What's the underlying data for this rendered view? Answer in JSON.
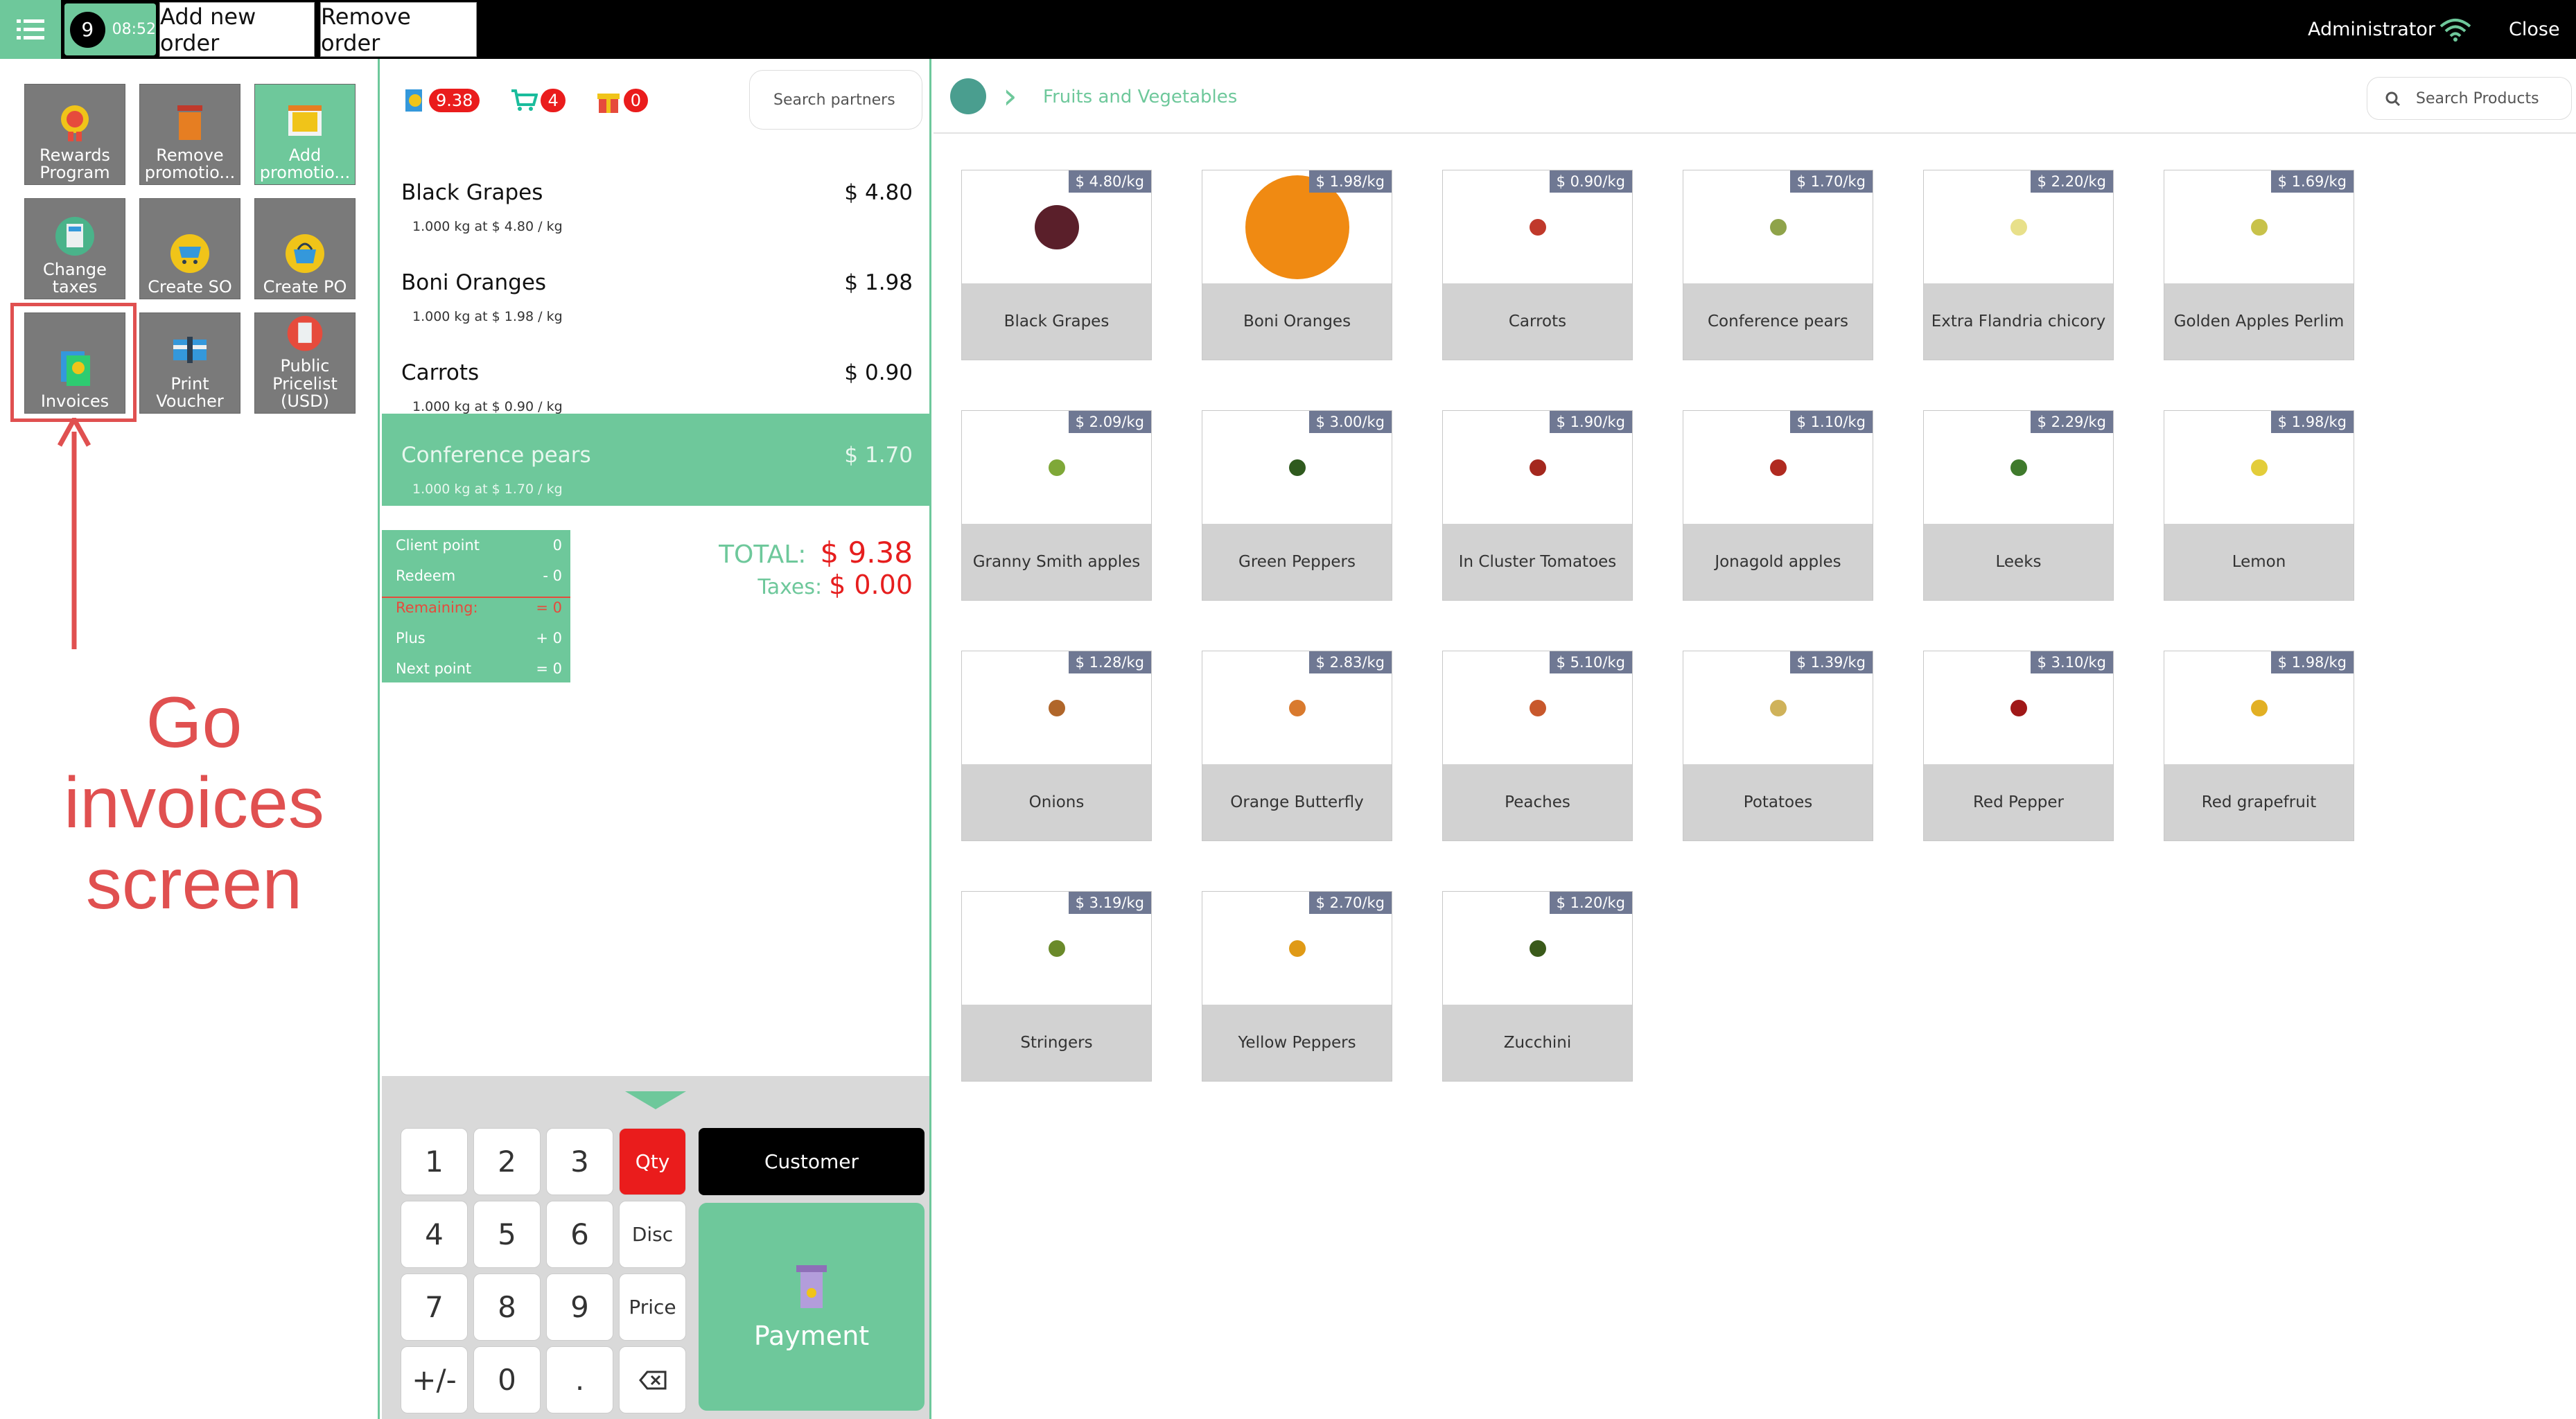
{
  "topbar": {
    "order_number": "9",
    "order_time": "08:52",
    "add_order_label": "Add new order",
    "remove_order_label": "Remove order",
    "user": "Administrator",
    "close_label": "Close"
  },
  "controls": [
    {
      "label": "Rewards\nProgram",
      "icon": "medal-icon",
      "style": "gray"
    },
    {
      "label": "Remove\npromotio...",
      "icon": "trash-icon",
      "style": "gray"
    },
    {
      "label": "Add\npromotio...",
      "icon": "promo-icon",
      "style": "green"
    },
    {
      "label": "Change\ntaxes",
      "icon": "calculator-icon",
      "style": "gray"
    },
    {
      "label": "Create SO",
      "icon": "cart-icon",
      "style": "gray"
    },
    {
      "label": "Create PO",
      "icon": "basket-icon",
      "style": "gray"
    },
    {
      "label": "Invoices",
      "icon": "invoice-icon",
      "style": "gray"
    },
    {
      "label": "Print\nVoucher",
      "icon": "voucher-icon",
      "style": "gray"
    },
    {
      "label": "Public\nPricelist\n(USD)",
      "icon": "pricelist-icon",
      "style": "gray"
    }
  ],
  "annotation": {
    "line1": "Go",
    "line2": "invoices",
    "line3": "screen"
  },
  "order_stats": {
    "points": "9.38",
    "cart_count": "4",
    "gift_count": "0"
  },
  "search_partners_placeholder": "Search partners",
  "order_lines": [
    {
      "name": "Black Grapes",
      "price": "$ 4.80",
      "info": "1.000 kg at $ 4.80 / kg",
      "selected": false
    },
    {
      "name": "Boni Oranges",
      "price": "$ 1.98",
      "info": "1.000 kg at $ 1.98 / kg",
      "selected": false
    },
    {
      "name": "Carrots",
      "price": "$ 0.90",
      "info": "1.000 kg at $ 0.90 / kg",
      "selected": false
    },
    {
      "name": "Conference pears",
      "price": "$ 1.70",
      "info": "1.000 kg at $ 1.70 / kg",
      "selected": true
    }
  ],
  "loyalty": [
    {
      "label": "Client point",
      "value": "0",
      "red": false
    },
    {
      "label": "Redeem",
      "value": "- 0",
      "red": false
    },
    {
      "label": "Remaining:",
      "value": "= 0",
      "red": true
    },
    {
      "label": "Plus",
      "value": "+ 0",
      "red": false
    },
    {
      "label": "Next point",
      "value": "= 0",
      "red": false
    }
  ],
  "totals": {
    "total_label": "TOTAL:",
    "total_value": "$ 9.38",
    "tax_label": "Taxes:",
    "tax_value": "$ 0.00"
  },
  "keypad": {
    "keys": [
      "1",
      "2",
      "3",
      "4",
      "5",
      "6",
      "7",
      "8",
      "9",
      "+/-",
      "0",
      "."
    ],
    "qty": "Qty",
    "disc": "Disc",
    "price": "Price",
    "customer": "Customer",
    "payment": "Payment"
  },
  "breadcrumb": {
    "category": "Fruits and Vegetables"
  },
  "search_products_placeholder": "Search Products",
  "products": [
    {
      "name": "Black Grapes",
      "price": "$ 4.80/kg",
      "color": "#5a1f2a"
    },
    {
      "name": "Boni Oranges",
      "price": "$ 1.98/kg",
      "color": "#f08a12"
    },
    {
      "name": "Carrots",
      "price": "$ 0.90/kg",
      "color": "#c0392b"
    },
    {
      "name": "Conference pears",
      "price": "$ 1.70/kg",
      "color": "#8fa34a"
    },
    {
      "name": "Extra Flandria chicory",
      "price": "$ 2.20/kg",
      "color": "#e8e08a"
    },
    {
      "name": "Golden Apples Perlim",
      "price": "$ 1.69/kg",
      "color": "#c8c24a"
    },
    {
      "name": "Granny Smith apples",
      "price": "$ 2.09/kg",
      "color": "#7fa838"
    },
    {
      "name": "Green Peppers",
      "price": "$ 3.00/kg",
      "color": "#2f5a1e"
    },
    {
      "name": "In Cluster Tomatoes",
      "price": "$ 1.90/kg",
      "color": "#a4281e"
    },
    {
      "name": "Jonagold apples",
      "price": "$ 1.10/kg",
      "color": "#b02a20"
    },
    {
      "name": "Leeks",
      "price": "$ 2.29/kg",
      "color": "#3f7a2c"
    },
    {
      "name": "Lemon",
      "price": "$ 1.98/kg",
      "color": "#e3cd3a"
    },
    {
      "name": "Onions",
      "price": "$ 1.28/kg",
      "color": "#b0662a"
    },
    {
      "name": "Orange Butterfly",
      "price": "$ 2.83/kg",
      "color": "#d97a2e"
    },
    {
      "name": "Peaches",
      "price": "$ 5.10/kg",
      "color": "#c8582c"
    },
    {
      "name": "Potatoes",
      "price": "$ 1.39/kg",
      "color": "#cfb25a"
    },
    {
      "name": "Red Pepper",
      "price": "$ 3.10/kg",
      "color": "#a01818"
    },
    {
      "name": "Red grapefruit",
      "price": "$ 1.98/kg",
      "color": "#e2b024"
    },
    {
      "name": "Stringers",
      "price": "$ 3.19/kg",
      "color": "#6a8a2a"
    },
    {
      "name": "Yellow Peppers",
      "price": "$ 2.70/kg",
      "color": "#e09a16"
    },
    {
      "name": "Zucchini",
      "price": "$ 1.20/kg",
      "color": "#3a5a1a"
    }
  ]
}
